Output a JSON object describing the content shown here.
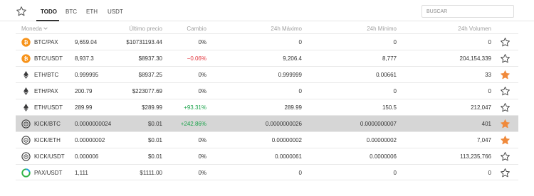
{
  "tabs": [
    {
      "label": "TODO",
      "active": true
    },
    {
      "label": "BTC",
      "active": false
    },
    {
      "label": "ETH",
      "active": false
    },
    {
      "label": "USDT",
      "active": false
    }
  ],
  "search": {
    "placeholder": "BUSCAR"
  },
  "columns": {
    "coin": "Moneda",
    "last_price": "Último precio",
    "change": "Cambio",
    "high": "24h Máximo",
    "low": "24h Mínimo",
    "volume": "24h Volumen"
  },
  "colors": {
    "accent_star": "#f08a3c",
    "positive": "#1aa34a",
    "negative": "#e2343c",
    "highlight_row": "#d6d6d6",
    "btc": "#f7931a"
  },
  "rows": [
    {
      "icon": "btc-icon",
      "pair": "BTC/PAX",
      "last": "9,659.04",
      "price": "$10731193.44",
      "change": "0%",
      "change_dir": "flat",
      "high": "0",
      "low": "0",
      "volume": "0",
      "favorite": false,
      "highlighted": false
    },
    {
      "icon": "btc-icon",
      "pair": "BTC/USDT",
      "last": "8,937.3",
      "price": "$8937.30",
      "change": "−0.06%",
      "change_dir": "neg",
      "high": "9,206.4",
      "low": "8,777",
      "volume": "204,154,339",
      "favorite": false,
      "highlighted": false
    },
    {
      "icon": "eth-icon",
      "pair": "ETH/BTC",
      "last": "0.999995",
      "price": "$8937.25",
      "change": "0%",
      "change_dir": "flat",
      "high": "0.999999",
      "low": "0.00661",
      "volume": "33",
      "favorite": true,
      "highlighted": false
    },
    {
      "icon": "eth-icon",
      "pair": "ETH/PAX",
      "last": "200.79",
      "price": "$223077.69",
      "change": "0%",
      "change_dir": "flat",
      "high": "0",
      "low": "0",
      "volume": "0",
      "favorite": false,
      "highlighted": false
    },
    {
      "icon": "eth-icon",
      "pair": "ETH/USDT",
      "last": "289.99",
      "price": "$289.99",
      "change": "+93.31%",
      "change_dir": "pos",
      "high": "289.99",
      "low": "150.5",
      "volume": "212,047",
      "favorite": false,
      "highlighted": false
    },
    {
      "icon": "kick-icon",
      "pair": "KICK/BTC",
      "last": "0.0000000024",
      "price": "$0.01",
      "change": "+242.86%",
      "change_dir": "pos",
      "high": "0.0000000026",
      "low": "0.0000000007",
      "volume": "401",
      "favorite": true,
      "highlighted": true
    },
    {
      "icon": "kick-icon",
      "pair": "KICK/ETH",
      "last": "0.00000002",
      "price": "$0.01",
      "change": "0%",
      "change_dir": "flat",
      "high": "0.00000002",
      "low": "0.00000002",
      "volume": "7,047",
      "favorite": true,
      "highlighted": false
    },
    {
      "icon": "kick-icon",
      "pair": "KICK/USDT",
      "last": "0.000006",
      "price": "$0.01",
      "change": "0%",
      "change_dir": "flat",
      "high": "0.0000061",
      "low": "0.0000006",
      "volume": "113,235,766",
      "favorite": false,
      "highlighted": false
    },
    {
      "icon": "pax-icon",
      "pair": "PAX/USDT",
      "last": "1,111",
      "price": "$1111.00",
      "change": "0%",
      "change_dir": "flat",
      "high": "0",
      "low": "0",
      "volume": "0",
      "favorite": false,
      "highlighted": false
    }
  ]
}
